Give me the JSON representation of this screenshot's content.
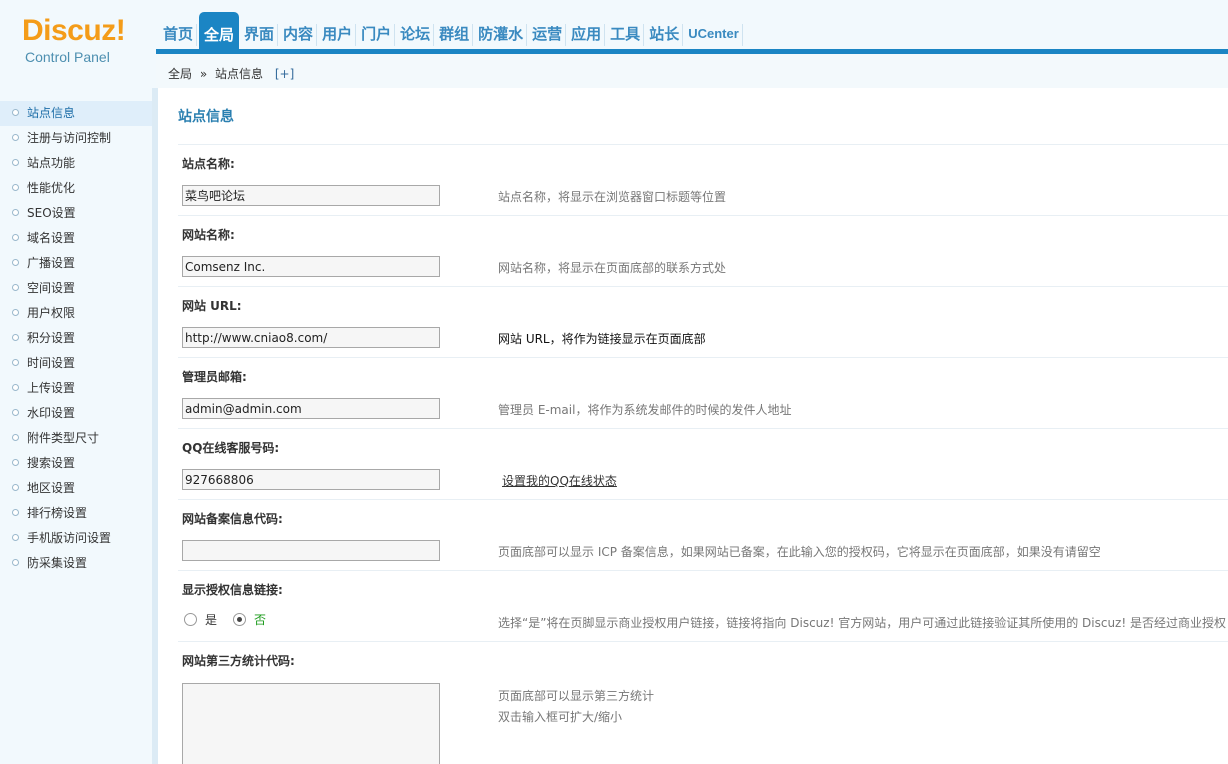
{
  "logo": {
    "word": "Discuz!",
    "subtitle": "Control Panel"
  },
  "nav": [
    "首页",
    "全局",
    "界面",
    "内容",
    "用户",
    "门户",
    "论坛",
    "群组",
    "防灌水",
    "运营",
    "应用",
    "工具",
    "站长",
    "UCenter"
  ],
  "nav_active": "全局",
  "breadcrumb": {
    "section": "全局",
    "separator": "»",
    "page": "站点信息",
    "add": "[+]"
  },
  "sidebar": {
    "items": [
      "站点信息",
      "注册与访问控制",
      "站点功能",
      "性能优化",
      "SEO设置",
      "域名设置",
      "广播设置",
      "空间设置",
      "用户权限",
      "积分设置",
      "时间设置",
      "上传设置",
      "水印设置",
      "附件类型尺寸",
      "搜索设置",
      "地区设置",
      "排行榜设置",
      "手机版访问设置",
      "防采集设置"
    ],
    "active": "站点信息"
  },
  "page_title": "站点信息",
  "settings": {
    "sitename": {
      "label": "站点名称:",
      "value": "菜鸟吧论坛",
      "tip": "站点名称，将显示在浏览器窗口标题等位置"
    },
    "webname": {
      "label": "网站名称:",
      "value": "Comsenz Inc.",
      "tip": "网站名称，将显示在页面底部的联系方式处"
    },
    "url": {
      "label": "网站 URL:",
      "value": "http://www.cniao8.com/",
      "tip": "网站 URL，将作为链接显示在页面底部"
    },
    "email": {
      "label": "管理员邮箱:",
      "value": "admin@admin.com",
      "tip": "管理员 E-mail，将作为系统发邮件的时候的发件人地址"
    },
    "qq": {
      "label": "QQ在线客服号码:",
      "value": "927668806",
      "tip": "设置我的QQ在线状态"
    },
    "icp": {
      "label": "网站备案信息代码:",
      "value": "",
      "tip": "页面底部可以显示 ICP 备案信息，如果网站已备案，在此输入您的授权码，它将显示在页面底部，如果没有请留空"
    },
    "license": {
      "label": "显示授权信息链接:",
      "yes": "是",
      "no": "否",
      "selected": "否",
      "tip": "选择“是”将在页脚显示商业授权用户链接，链接将指向 Discuz! 官方网站，用户可通过此链接验证其所使用的 Discuz! 是否经过商业授权"
    },
    "stat": {
      "label": "网站第三方统计代码:",
      "tip1": "页面底部可以显示第三方统计",
      "tip2": "双击输入框可扩大/缩小"
    }
  }
}
